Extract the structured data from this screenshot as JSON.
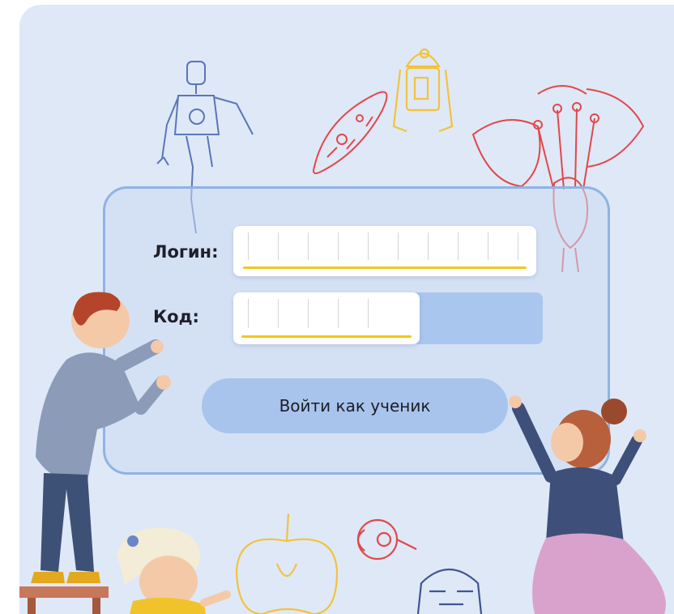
{
  "form": {
    "login_label": "Логин:",
    "code_label": "Код:",
    "login_value": "",
    "code_value": "",
    "submit_label": "Войти как ученик"
  },
  "colors": {
    "background": "#dfe8f7",
    "panel_border": "#8fb3e3",
    "button": "#a8c4ec",
    "underline": "#f4c61a"
  },
  "illustrations": [
    "robot-sketch",
    "droid-sketch",
    "paramecium-sketch",
    "flower-sketch",
    "apple-sketch",
    "eye-sketch",
    "helmet-sketch",
    "boy-illustration",
    "girl-right-illustration",
    "girl-bottom-illustration"
  ]
}
